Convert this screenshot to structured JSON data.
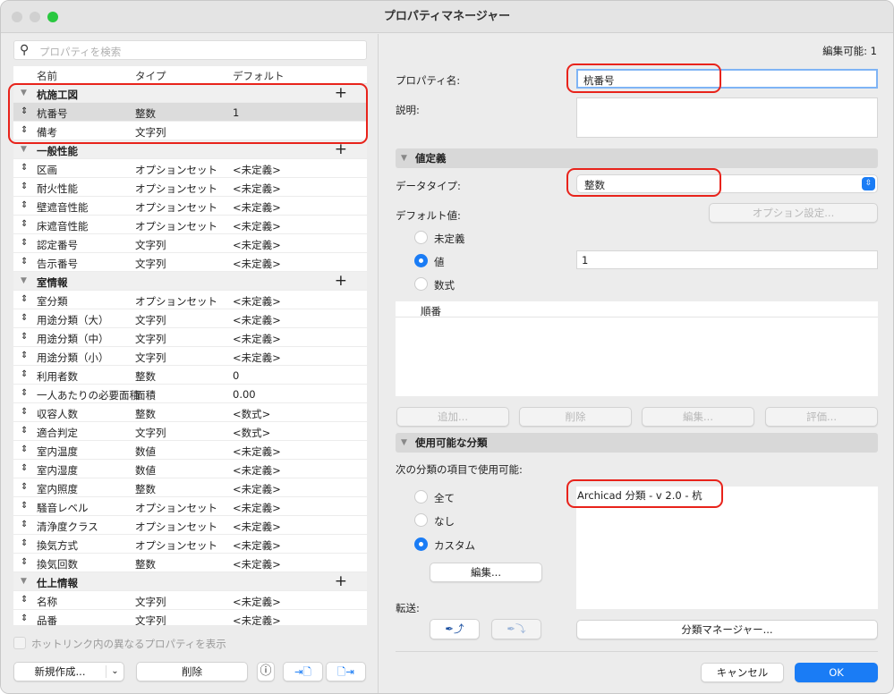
{
  "window": {
    "title": "プロパティマネージャー"
  },
  "left": {
    "search_placeholder": "プロパティを検索",
    "columns": [
      "名前",
      "タイプ",
      "デフォルト"
    ],
    "rows": [
      {
        "group": "杭施工図"
      },
      {
        "name": "杭番号",
        "type": "整数",
        "default": "1",
        "selected": true
      },
      {
        "name": "備考",
        "type": "文字列",
        "default": ""
      },
      {
        "group": "一般性能"
      },
      {
        "name": "区画",
        "type": "オプションセット",
        "default": "<未定義>"
      },
      {
        "name": "耐火性能",
        "type": "オプションセット",
        "default": "<未定義>"
      },
      {
        "name": "壁遮音性能",
        "type": "オプションセット",
        "default": "<未定義>"
      },
      {
        "name": "床遮音性能",
        "type": "オプションセット",
        "default": "<未定義>"
      },
      {
        "name": "認定番号",
        "type": "文字列",
        "default": "<未定義>"
      },
      {
        "name": "告示番号",
        "type": "文字列",
        "default": "<未定義>"
      },
      {
        "group": "室情報"
      },
      {
        "name": "室分類",
        "type": "オプションセット",
        "default": "<未定義>"
      },
      {
        "name": "用途分類（大）",
        "type": "文字列",
        "default": "<未定義>"
      },
      {
        "name": "用途分類（中）",
        "type": "文字列",
        "default": "<未定義>"
      },
      {
        "name": "用途分類（小）",
        "type": "文字列",
        "default": "<未定義>"
      },
      {
        "name": "利用者数",
        "type": "整数",
        "default": "0"
      },
      {
        "name": "一人あたりの必要面積",
        "type": "面積",
        "default": "0.00"
      },
      {
        "name": "収容人数",
        "type": "整数",
        "default": "<数式>"
      },
      {
        "name": "適合判定",
        "type": "文字列",
        "default": "<数式>"
      },
      {
        "name": "室内温度",
        "type": "数値",
        "default": "<未定義>"
      },
      {
        "name": "室内湿度",
        "type": "数値",
        "default": "<未定義>"
      },
      {
        "name": "室内照度",
        "type": "整数",
        "default": "<未定義>"
      },
      {
        "name": "騒音レベル",
        "type": "オプションセット",
        "default": "<未定義>"
      },
      {
        "name": "清浄度クラス",
        "type": "オプションセット",
        "default": "<未定義>"
      },
      {
        "name": "換気方式",
        "type": "オプションセット",
        "default": "<未定義>"
      },
      {
        "name": "換気回数",
        "type": "整数",
        "default": "<未定義>"
      },
      {
        "group": "仕上情報"
      },
      {
        "name": "名称",
        "type": "文字列",
        "default": "<未定義>"
      },
      {
        "name": "品番",
        "type": "文字列",
        "default": "<未定義>"
      }
    ],
    "hotlink_checkbox": "ホットリンク内の異なるプロパティを表示",
    "new_button": "新規作成...",
    "delete_button": "削除"
  },
  "right": {
    "editable": "編集可能: 1",
    "name_label": "プロパティ名:",
    "name_value": "杭番号",
    "desc_label": "説明:",
    "value_section": "値定義",
    "datatype_label": "データタイプ:",
    "datatype_value": "整数",
    "default_label": "デフォルト値:",
    "option_button": "オプション設定...",
    "radio_undefined": "未定義",
    "radio_value": "値",
    "radio_formula": "数式",
    "value": "1",
    "order_header": "順番",
    "add": "追加...",
    "delete": "削除",
    "edit": "編集...",
    "evaluate": "評価...",
    "class_section": "使用可能な分類",
    "class_label": "次の分類の項目で使用可能:",
    "radio_all": "全て",
    "radio_none": "なし",
    "radio_custom": "カスタム",
    "edit_button": "編集...",
    "class_item": "Archicad 分類 - v 2.0 - 杭",
    "transfer_label": "転送:",
    "class_manager": "分類マネージャー...",
    "cancel": "キャンセル",
    "ok": "OK"
  },
  "colors": {
    "accent": "#1a7cf5",
    "annotation": "#e8231b"
  }
}
